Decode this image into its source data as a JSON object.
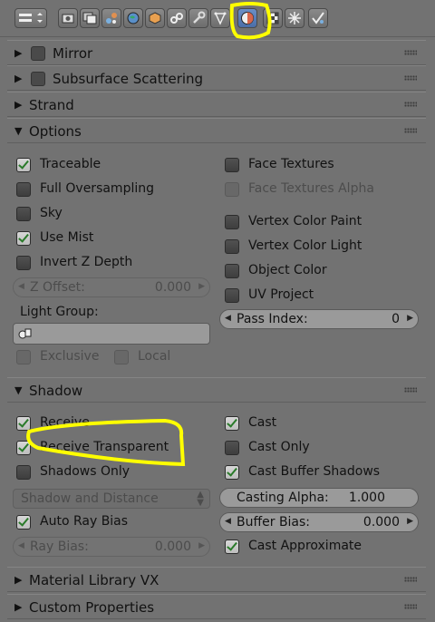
{
  "toolbar": {
    "icons": [
      "view-menu-icon",
      "render-icon",
      "render-layers-icon",
      "scene-icon",
      "world-icon",
      "object-icon",
      "constraints-icon",
      "modifiers-icon",
      "data-icon",
      "material-icon",
      "texture-icon",
      "particles-icon",
      "physics-icon"
    ],
    "active": "material-icon"
  },
  "panels": {
    "mirror": {
      "label": "Mirror",
      "checked": false
    },
    "sss": {
      "label": "Subsurface Scattering",
      "checked": false
    },
    "strand": {
      "label": "Strand"
    },
    "options": {
      "label": "Options",
      "left": [
        {
          "label": "Traceable",
          "checked": true
        },
        {
          "label": "Full Oversampling",
          "checked": false
        },
        {
          "label": "Sky",
          "checked": false
        },
        {
          "label": "Use Mist",
          "checked": true
        },
        {
          "label": "Invert Z Depth",
          "checked": false
        }
      ],
      "right": [
        {
          "label": "Face Textures",
          "checked": false
        },
        {
          "label": "Face Textures Alpha",
          "checked": false,
          "disabled": true
        },
        {
          "label": "Vertex Color Paint",
          "checked": false
        },
        {
          "label": "Vertex Color Light",
          "checked": false
        },
        {
          "label": "Object Color",
          "checked": false
        },
        {
          "label": "UV Project",
          "checked": false
        }
      ],
      "z_offset": {
        "label": "Z Offset:",
        "value": "0.000"
      },
      "pass_index": {
        "label": "Pass Index:",
        "value": "0"
      },
      "light_group_label": "Light Group:",
      "exclusive": "Exclusive",
      "local": "Local"
    },
    "shadow": {
      "label": "Shadow",
      "left": [
        {
          "label": "Receive",
          "checked": true
        },
        {
          "label": "Receive Transparent",
          "checked": true
        },
        {
          "label": "Shadows Only",
          "checked": false
        }
      ],
      "right": [
        {
          "label": "Cast",
          "checked": true
        },
        {
          "label": "Cast Only",
          "checked": false
        },
        {
          "label": "Cast Buffer Shadows",
          "checked": true
        }
      ],
      "shadow_mode": "Shadow and Distance",
      "casting_alpha": {
        "label": "Casting Alpha:",
        "value": "1.000"
      },
      "auto_ray_bias": {
        "label": "Auto Ray Bias",
        "checked": true
      },
      "buffer_bias": {
        "label": "Buffer Bias:",
        "value": "0.000"
      },
      "ray_bias": {
        "label": "Ray Bias:",
        "value": "0.000"
      },
      "cast_approximate": {
        "label": "Cast Approximate",
        "checked": true
      }
    },
    "material_library": {
      "label": "Material Library VX"
    },
    "custom_properties": {
      "label": "Custom Properties"
    }
  },
  "colors": {
    "annotation": "#ffff00",
    "check": "#2a7a2a",
    "background": "#727272"
  }
}
